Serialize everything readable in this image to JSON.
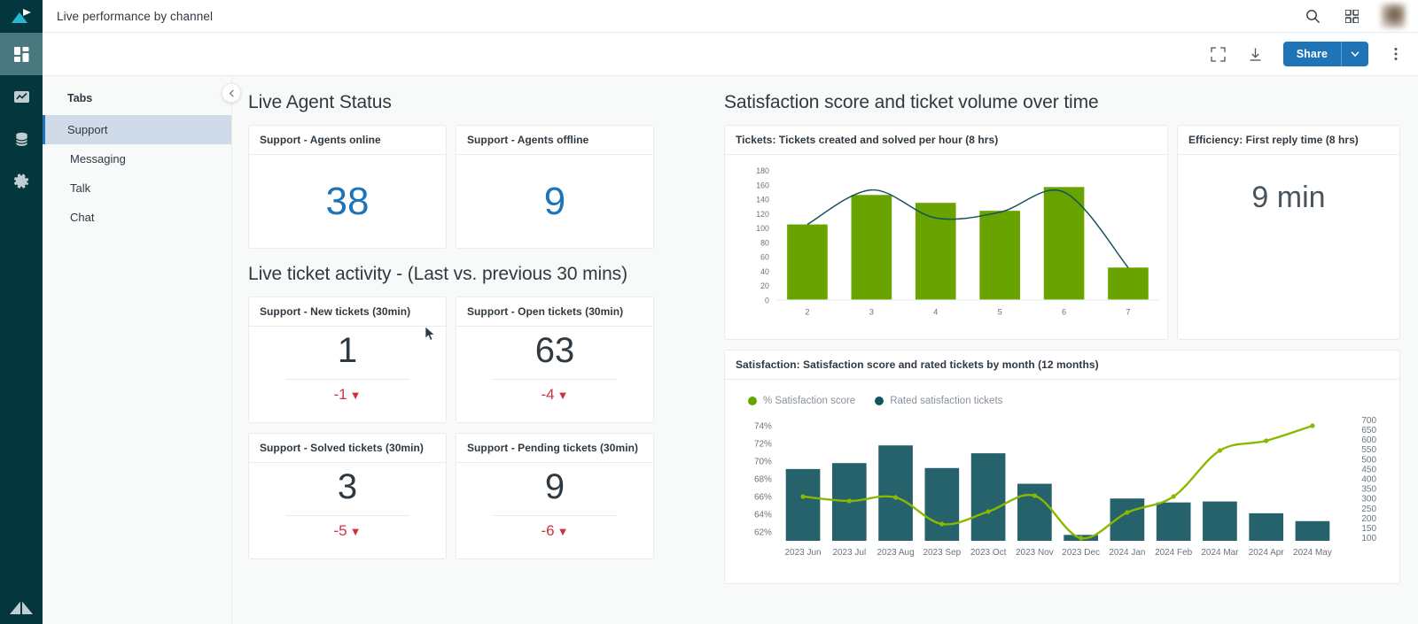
{
  "topbar": {
    "title": "Live performance by channel",
    "search_icon": "search-icon",
    "apps_icon": "apps-grid-icon",
    "avatar": "user-avatar"
  },
  "toolbar": {
    "fullscreen_icon": "fullscreen-icon",
    "download_icon": "download-icon",
    "share_label": "Share",
    "share_caret_icon": "chevron-down-icon",
    "more_icon": "kebab-menu-icon"
  },
  "rail": {
    "logo": "zendesk-explore-logo",
    "items": [
      {
        "name": "dashboards-icon",
        "active": true
      },
      {
        "name": "reports-chart-icon",
        "active": false
      },
      {
        "name": "datasets-database-icon",
        "active": false
      },
      {
        "name": "settings-gear-icon",
        "active": false
      }
    ],
    "footer_logo": "zendesk-logo"
  },
  "tabs_panel": {
    "heading": "Tabs",
    "collapse_icon": "chevron-left-icon",
    "items": [
      {
        "label": "Support",
        "active": true
      },
      {
        "label": "Messaging",
        "active": false
      },
      {
        "label": "Talk",
        "active": false
      },
      {
        "label": "Chat",
        "active": false
      }
    ]
  },
  "agent_status": {
    "title": "Live Agent Status",
    "cards": [
      {
        "title": "Support - Agents online",
        "value": "38"
      },
      {
        "title": "Support - Agents offline",
        "value": "9"
      }
    ]
  },
  "ticket_activity": {
    "title": "Live ticket activity - (Last vs. previous 30 mins)",
    "cards": [
      {
        "title": "Support - New tickets (30min)",
        "value": "1",
        "delta": "-1",
        "trend": "down"
      },
      {
        "title": "Support - Open tickets (30min)",
        "value": "63",
        "delta": "-4",
        "trend": "down"
      },
      {
        "title": "Support - Solved tickets (30min)",
        "value": "3",
        "delta": "-5",
        "trend": "down"
      },
      {
        "title": "Support - Pending tickets (30min)",
        "value": "9",
        "delta": "-6",
        "trend": "down"
      }
    ]
  },
  "right_section": {
    "title": "Satisfaction score and ticket volume over time",
    "tickets_panel_title": "Tickets: Tickets created and solved per hour (8 hrs)",
    "efficiency_panel_title": "Efficiency: First reply time (8 hrs)",
    "efficiency_value": "9 min",
    "satisfaction_panel_title": "Satisfaction: Satisfaction score and rated tickets by month (12 months)"
  },
  "colors": {
    "accent_blue": "#1f73b7",
    "green": "#68a300",
    "teal": "#25626c",
    "dark_teal_line": "#14505c",
    "red": "#cc3340",
    "rail_bg": "#03363d",
    "rail_active": "#49797f"
  },
  "chart_data": [
    {
      "type": "bar",
      "id": "tickets-per-hour",
      "title": "Tickets: Tickets created and solved per hour (8 hrs)",
      "categories": [
        "2",
        "3",
        "4",
        "5",
        "6",
        "7"
      ],
      "ylabel": "",
      "xlabel": "",
      "ylim": [
        0,
        180
      ],
      "yticks": [
        0,
        20,
        40,
        60,
        80,
        100,
        120,
        140,
        160,
        180
      ],
      "grid": false,
      "series": [
        {
          "name": "Tickets created",
          "render": "bar",
          "color": "#68a300",
          "values": [
            105,
            146,
            135,
            124,
            157,
            45
          ]
        },
        {
          "name": "Tickets solved",
          "render": "line",
          "color": "#14505c",
          "values": [
            105,
            153,
            114,
            122,
            150,
            45
          ]
        }
      ]
    },
    {
      "type": "bar",
      "id": "satisfaction-by-month",
      "title": "Satisfaction: Satisfaction score and rated tickets by month (12 months)",
      "categories": [
        "2023 Jun",
        "2023 Jul",
        "2023 Aug",
        "2023 Sep",
        "2023 Oct",
        "2023 Nov",
        "2023 Dec",
        "2024 Jan",
        "2024 Feb",
        "2024 Mar",
        "2024 Apr",
        "2024 May"
      ],
      "legend": [
        "% Satisfaction score",
        "Rated satisfaction tickets"
      ],
      "legend_position": "top-left",
      "grid": false,
      "left_axis": {
        "label": "% Satisfaction score",
        "ticks": [
          "62%",
          "64%",
          "66%",
          "68%",
          "70%",
          "72%",
          "74%"
        ],
        "min": 61,
        "max": 75
      },
      "right_axis": {
        "label": "Rated satisfaction tickets",
        "ticks": [
          100,
          150,
          200,
          250,
          300,
          350,
          400,
          450,
          500,
          550,
          600,
          650,
          700
        ],
        "min": 85,
        "max": 715
      },
      "series": [
        {
          "name": "Rated satisfaction tickets",
          "render": "bar",
          "color": "#25626c",
          "axis": "right",
          "values": [
            450,
            480,
            570,
            455,
            530,
            375,
            115,
            300,
            280,
            285,
            225,
            185
          ]
        },
        {
          "name": "% Satisfaction score",
          "render": "line",
          "color": "#8ab800",
          "axis": "left",
          "values": [
            66.0,
            65.5,
            65.9,
            62.9,
            64.3,
            66.1,
            61.3,
            64.2,
            66.0,
            71.2,
            72.3,
            74.0
          ]
        }
      ]
    }
  ]
}
